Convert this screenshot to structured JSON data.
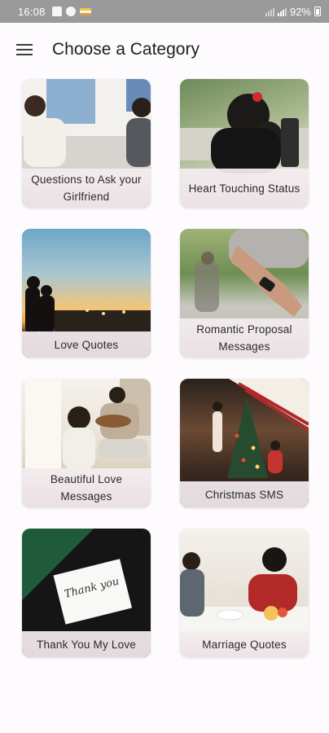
{
  "status_bar": {
    "time": "16:08",
    "battery": "92%"
  },
  "app_bar": {
    "menu_icon": "menu-icon",
    "title": "Choose a Category"
  },
  "categories": [
    {
      "label": "Questions to Ask your Girlfriend"
    },
    {
      "label": "Heart Touching Status"
    },
    {
      "label": "Love Quotes"
    },
    {
      "label": "Romantic Proposal Messages"
    },
    {
      "label": "Beautiful Love Messages"
    },
    {
      "label": "Christmas SMS"
    },
    {
      "label": "Thank You My Love"
    },
    {
      "label": "Marriage Quotes"
    }
  ],
  "note_text": "Thank you"
}
